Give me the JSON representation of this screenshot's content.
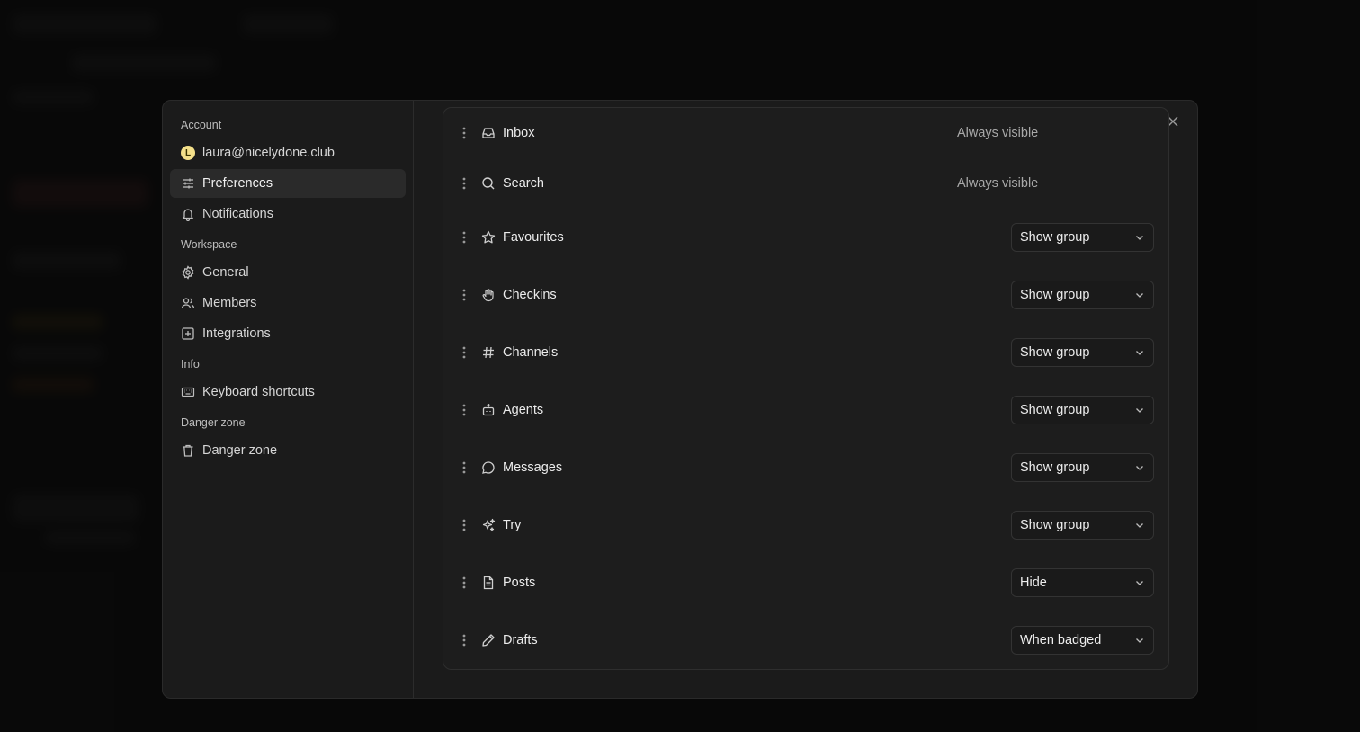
{
  "sidebar": {
    "account_label": "Account",
    "account": {
      "avatar_letter": "L",
      "email": "laura@nicelydone.club"
    },
    "preferences": "Preferences",
    "notifications": "Notifications",
    "workspace_label": "Workspace",
    "general": "General",
    "members": "Members",
    "integrations": "Integrations",
    "info_label": "Info",
    "keyboard_shortcuts": "Keyboard shortcuts",
    "danger_label": "Danger zone",
    "danger_zone": "Danger zone"
  },
  "rows": [
    {
      "label": "Inbox",
      "icon": "inbox-icon",
      "status": "Always visible"
    },
    {
      "label": "Search",
      "icon": "search-icon",
      "status": "Always visible"
    },
    {
      "label": "Favourites",
      "icon": "star-icon",
      "value": "Show group"
    },
    {
      "label": "Checkins",
      "icon": "hand-icon",
      "value": "Show group"
    },
    {
      "label": "Channels",
      "icon": "hash-icon",
      "value": "Show group"
    },
    {
      "label": "Agents",
      "icon": "bot-icon",
      "value": "Show group"
    },
    {
      "label": "Messages",
      "icon": "message-icon",
      "value": "Show group"
    },
    {
      "label": "Try",
      "icon": "sparkle-icon",
      "value": "Show group"
    },
    {
      "label": "Posts",
      "icon": "document-icon",
      "value": "Hide"
    },
    {
      "label": "Drafts",
      "icon": "pencil-icon",
      "value": "When badged"
    }
  ],
  "colors": {
    "background": "#0b0b0b",
    "modal": "#1b1b1b",
    "active_item": "#2a2a2a",
    "avatar": "#f4e08a"
  }
}
